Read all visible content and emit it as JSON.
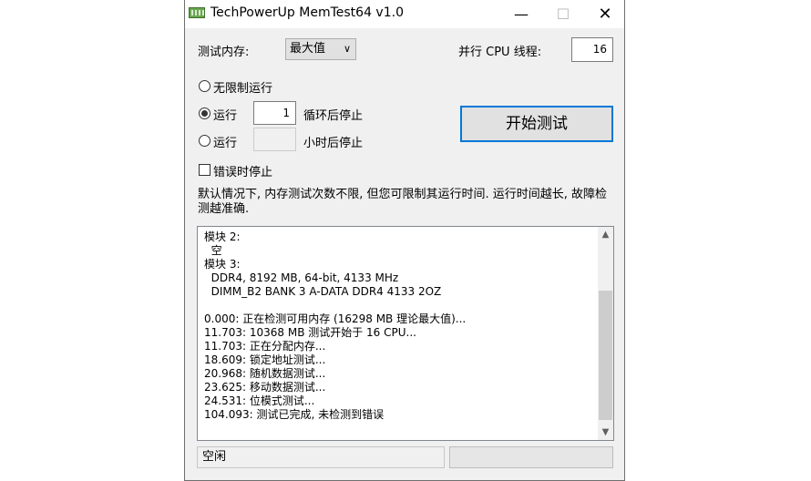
{
  "window": {
    "title": "TechPowerUp MemTest64 v1.0",
    "controls": {
      "minimize": "—",
      "maximize": "☐",
      "close": "✕"
    }
  },
  "memory": {
    "label": "测试内存:",
    "selected": "最大值",
    "dropdown_icon": "chevron-down-icon"
  },
  "threads": {
    "label": "并行 CPU 线程:",
    "value": "16"
  },
  "run_mode": {
    "unlimited_label": "无限制运行",
    "loops_prefix": "运行",
    "loops_value": "1",
    "loops_suffix": "循环后停止",
    "hours_prefix": "运行",
    "hours_value": "",
    "hours_suffix": "小时后停止",
    "selected": "loops"
  },
  "stop_on_error": {
    "label": "错误时停止",
    "checked": false
  },
  "start_button": {
    "label": "开始测试"
  },
  "description": "默认情况下, 内存测试次数不限, 但您可限制其运行时间. 运行时间越长, 故障检测越准确.",
  "log": {
    "lines": [
      "模块 2:",
      "  空",
      "模块 3:",
      "  DDR4, 8192 MB, 64-bit, 4133 MHz",
      "  DIMM_B2 BANK 3 A-DATA DDR4 4133 2OZ",
      "",
      "0.000: 正在检测可用内存 (16298 MB 理论最大值)...",
      "11.703: 10368 MB 测试开始于 16 CPU...",
      "11.703: 正在分配内存...",
      "18.609: 锁定地址测试...",
      "20.968: 随机数据测试...",
      "23.625: 移动数据测试...",
      "24.531: 位模式测试...",
      "104.093: 测试已完成, 未检测到错误"
    ],
    "scroll_up_icon": "scroll-up-arrow-icon",
    "scroll_down_icon": "scroll-down-arrow-icon"
  },
  "status": {
    "text": "空闲",
    "progress": 0
  },
  "colors": {
    "window_bg": "#f0f0f0",
    "accent_border": "#0078d7",
    "progress_fill": "#06b025"
  }
}
